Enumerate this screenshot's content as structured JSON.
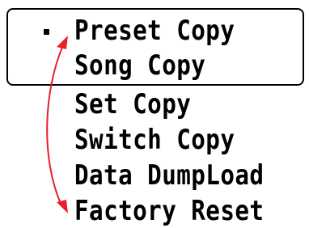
{
  "menu": {
    "items": [
      {
        "label": "Preset Copy",
        "selected": true
      },
      {
        "label": "Song Copy",
        "selected": false
      },
      {
        "label": "Set Copy",
        "selected": false
      },
      {
        "label": "Switch Copy",
        "selected": false
      },
      {
        "label": "Data DumpLoad",
        "selected": false
      },
      {
        "label": "Factory Reset",
        "selected": false
      }
    ]
  },
  "colors": {
    "text": "#000000",
    "background": "#ffffff",
    "scroll_arrow": "#e8202a"
  },
  "icons": {
    "cursor": "selection-cursor-icon",
    "scroll": "scroll-range-arrow-icon"
  }
}
